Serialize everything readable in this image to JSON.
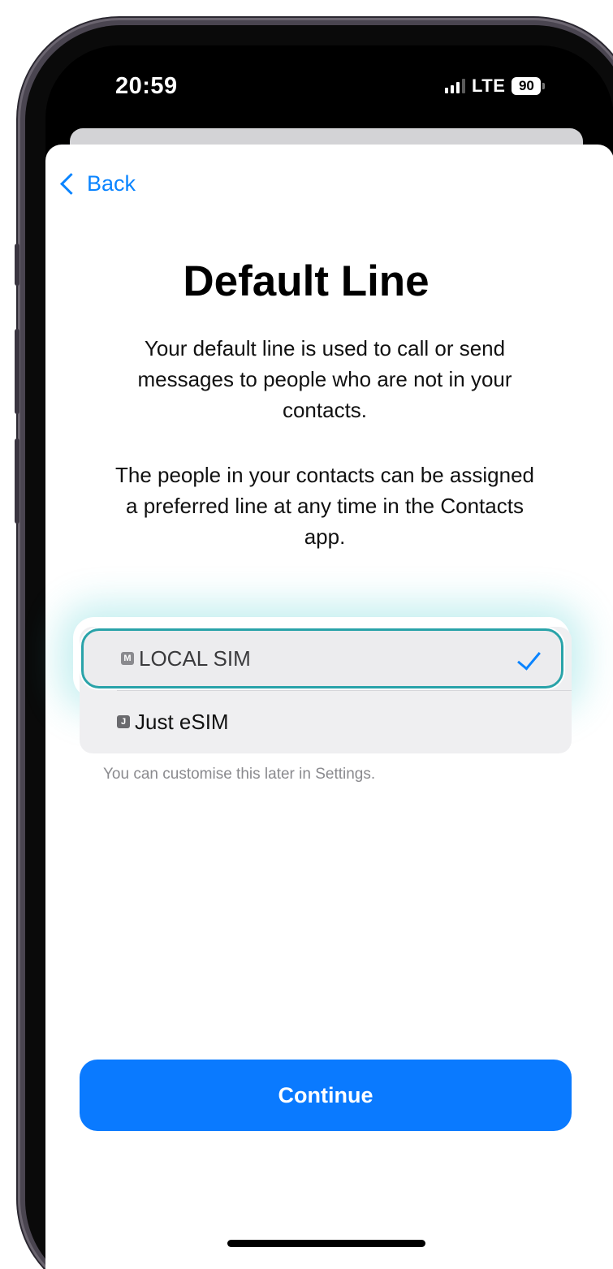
{
  "status_bar": {
    "time": "20:59",
    "network": "LTE",
    "battery": "90"
  },
  "nav": {
    "back_label": "Back"
  },
  "page": {
    "title": "Default Line",
    "description_1": "Your default line is used to call or send messages to people who are not in your contacts.",
    "description_2": "The people in your contacts can be assigned a preferred line at any time in the Contacts app."
  },
  "lines": [
    {
      "badge": "M",
      "label": "LOCAL SIM",
      "selected": true
    },
    {
      "badge": "J",
      "label": "Just eSIM",
      "selected": false
    }
  ],
  "footnote": "You can customise this later in Settings.",
  "continue_label": "Continue",
  "colors": {
    "accent": "#0a84ff",
    "button": "#0a7aff",
    "highlight_outline": "#29a3a9"
  }
}
